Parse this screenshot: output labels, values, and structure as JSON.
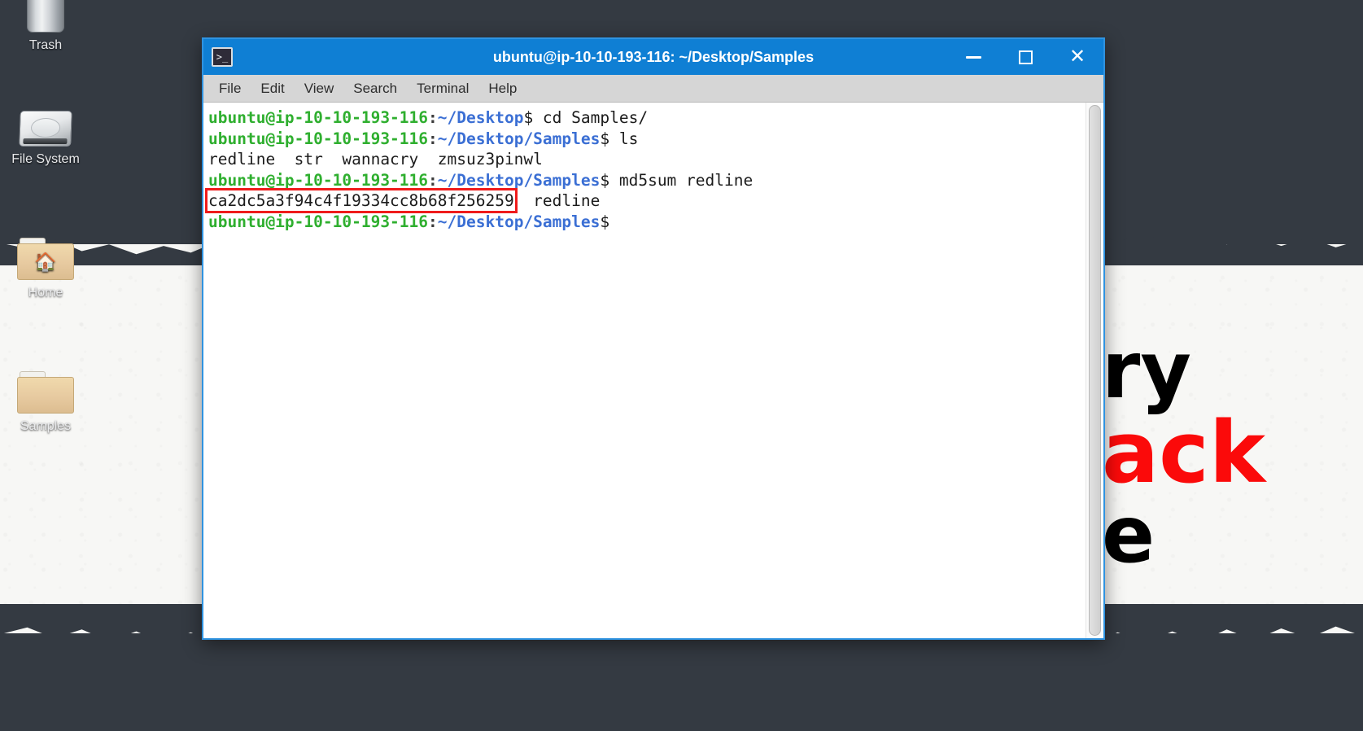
{
  "desktop": {
    "icons": [
      {
        "label": "Trash",
        "icon": "trash-icon"
      },
      {
        "label": "File System",
        "icon": "hard-drive-icon"
      },
      {
        "label": "Home",
        "icon": "home-folder-icon"
      },
      {
        "label": "Samples",
        "icon": "folder-icon"
      }
    ],
    "wallpaper": {
      "line1": "ry",
      "line2": "ack",
      "line3": "e",
      "text_color": "#000000",
      "accent_color": "#fb0a0a",
      "background_color": "#343a42"
    }
  },
  "terminal": {
    "title": "ubuntu@ip-10-10-193-116: ~/Desktop/Samples",
    "icon": "terminal-icon",
    "titlebar_color": "#0f7fd4",
    "window_buttons": {
      "minimize": "minimize-icon",
      "maximize": "maximize-icon",
      "close": "close-icon"
    },
    "menu": [
      "File",
      "Edit",
      "View",
      "Search",
      "Terminal",
      "Help"
    ],
    "prompt": {
      "user_host": "ubuntu@ip-10-10-193-116",
      "separator": ":",
      "symbol": "$"
    },
    "lines": [
      {
        "type": "prompt",
        "path": "~/Desktop",
        "command": " cd Samples/"
      },
      {
        "type": "prompt",
        "path": "~/Desktop/Samples",
        "command": " ls"
      },
      {
        "type": "output",
        "text": "redline  str  wannacry  zmsuz3pinwl"
      },
      {
        "type": "prompt",
        "path": "~/Desktop/Samples",
        "command": " md5sum redline"
      },
      {
        "type": "hash",
        "hash": "ca2dc5a3f94c4f19334cc8b68f256259",
        "suffix": "  redline",
        "highlight_color": "#ef1b1b"
      },
      {
        "type": "prompt",
        "path": "~/Desktop/Samples",
        "command": ""
      }
    ]
  }
}
